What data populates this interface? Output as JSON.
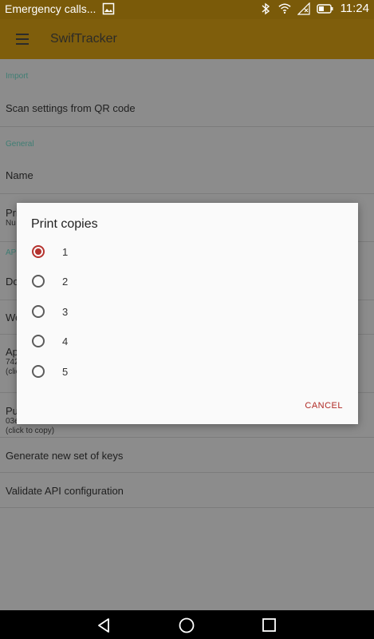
{
  "status_bar": {
    "notification_text": "Emergency calls...",
    "time": "11:24",
    "icons": [
      "image-icon",
      "bluetooth-icon",
      "wifi-icon",
      "signal-icon",
      "battery-icon"
    ]
  },
  "app_bar": {
    "title": "SwifTracker"
  },
  "sections": {
    "import": {
      "header": "Import",
      "scan_title": "Scan settings from QR code"
    },
    "general": {
      "header": "General",
      "name_title": "Name",
      "print_title": "Pri",
      "print_sub": "Nu",
      "api_header": "AP",
      "do_title": "Do",
      "we_title": "We",
      "ap_title": "Ap",
      "ap_sub1": "742",
      "ap_sub2": "(clic",
      "pub_title": "Pu",
      "pub_key": "03ed47b0066d2cb5a2acaae16b3259e97a95894ee9e27fe5a91124b49b3c8b02",
      "pub_hint": "(click to copy)",
      "generate_title": "Generate new set of keys",
      "validate_title": "Validate API configuration"
    }
  },
  "dialog": {
    "title": "Print copies",
    "options": [
      "1",
      "2",
      "3",
      "4",
      "5"
    ],
    "selected": "1",
    "cancel_label": "CANCEL"
  },
  "colors": {
    "accent": "#b5322e",
    "app_bar": "#7f5e0c",
    "section_header": "#3f7e74"
  }
}
